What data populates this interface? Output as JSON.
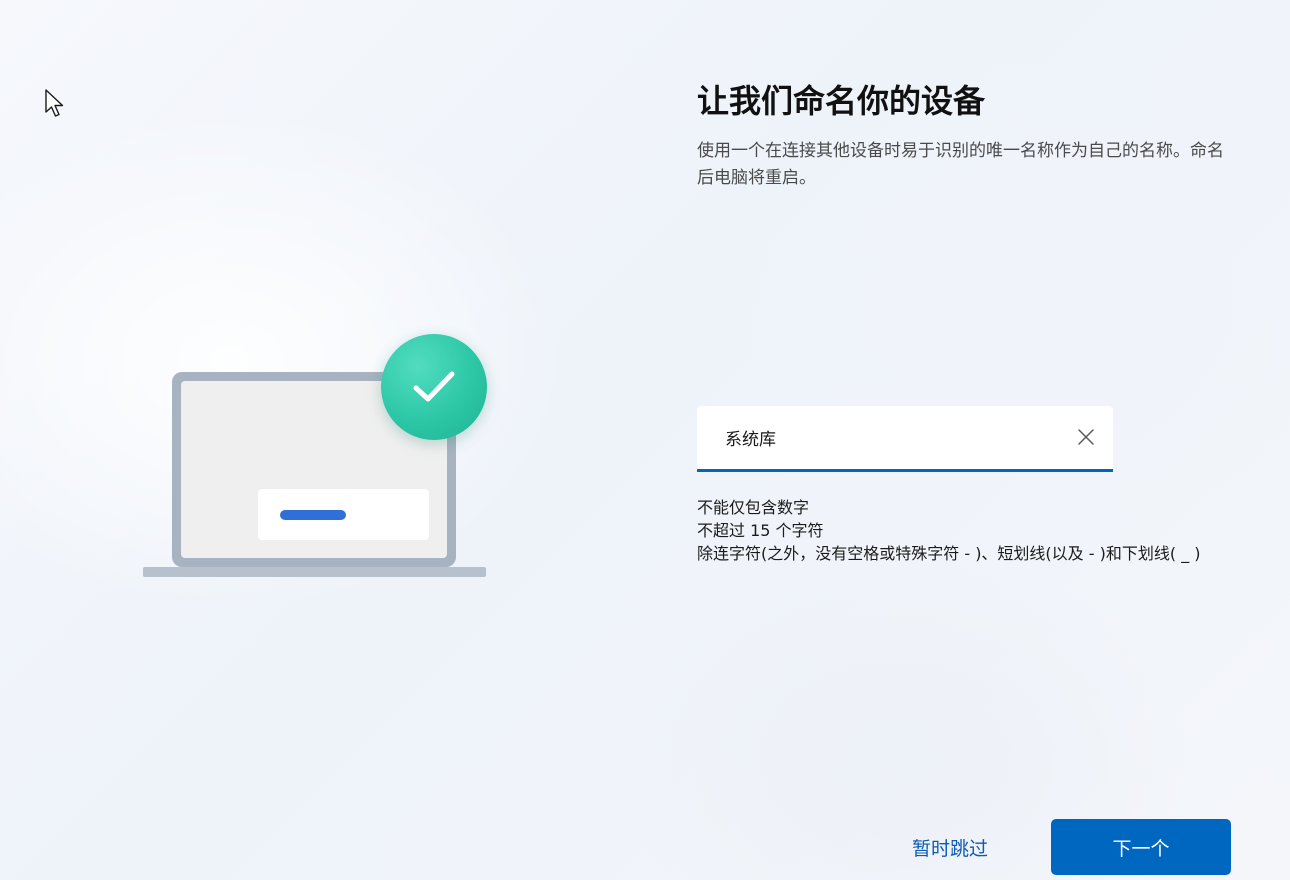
{
  "page": {
    "title": "让我们命名你的设备",
    "description": "使用一个在连接其他设备时易于识别的唯一名称作为自己的名称。命名后电脑将重启。"
  },
  "name_input": {
    "value": "系统库",
    "clear_icon": "close-icon"
  },
  "rules": [
    "不能仅包含数字",
    "不超过 15 个字符",
    "除连字符(之外，没有空格或特殊字符 - )、短划线(以及 - )和下划线( _ )"
  ],
  "footer": {
    "skip_label": "暂时跳过",
    "next_label": "下一个"
  },
  "illustration": {
    "icons": [
      "laptop-icon",
      "checkmark-icon"
    ]
  },
  "colors": {
    "accent": "#0067c0",
    "link": "#0b5bb5",
    "check_badge": "#2cc7a6",
    "laptop_frame": "#a7b3c1"
  }
}
